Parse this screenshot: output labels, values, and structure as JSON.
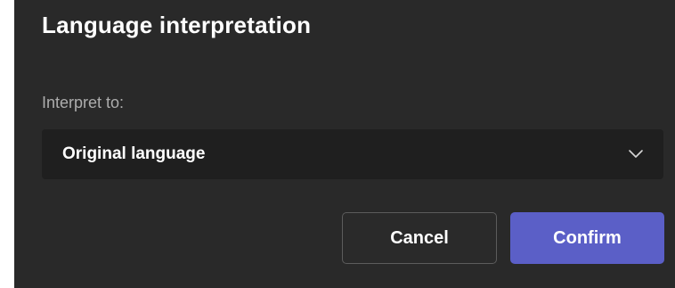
{
  "dialog": {
    "title": "Language interpretation",
    "field_label": "Interpret to:",
    "select": {
      "selected_value": "Original language",
      "icon": "chevron-down-icon"
    },
    "buttons": {
      "cancel_label": "Cancel",
      "confirm_label": "Confirm"
    }
  },
  "colors": {
    "background": "#292929",
    "select_background": "#1f1f1f",
    "accent": "#5b5fc7",
    "label_text": "#adadad"
  }
}
